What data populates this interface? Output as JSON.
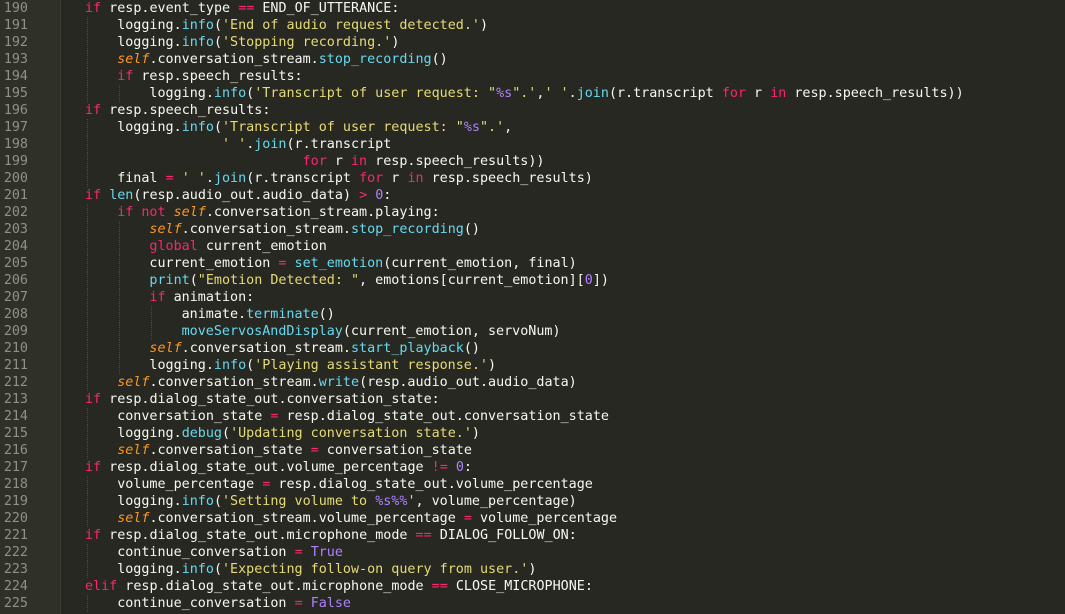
{
  "editor": {
    "theme_colors": {
      "background": "#272822",
      "gutter": "#2f3129",
      "line_number": "#8f908a",
      "plain": "#f8f8f2",
      "keyword": "#f92672",
      "function": "#66d9ef",
      "self": "#fd971f",
      "string": "#e6db74",
      "number": "#ae81ff"
    },
    "lines": [
      {
        "num": "190",
        "indent": 2,
        "tokens": [
          [
            "kw",
            "if"
          ],
          [
            "pl",
            " resp.event_type "
          ],
          [
            "kw",
            "=="
          ],
          [
            "pl",
            " END_OF_UTTERANCE:"
          ]
        ]
      },
      {
        "num": "191",
        "indent": 3,
        "tokens": [
          [
            "pl",
            "logging."
          ],
          [
            "fn",
            "info"
          ],
          [
            "pl",
            "("
          ],
          [
            "st",
            "'End of audio request detected.'"
          ],
          [
            "pl",
            ")"
          ]
        ]
      },
      {
        "num": "192",
        "indent": 3,
        "tokens": [
          [
            "pl",
            "logging."
          ],
          [
            "fn",
            "info"
          ],
          [
            "pl",
            "("
          ],
          [
            "st",
            "'Stopping recording.'"
          ],
          [
            "pl",
            ")"
          ]
        ]
      },
      {
        "num": "193",
        "indent": 3,
        "tokens": [
          [
            "slf",
            "self"
          ],
          [
            "pl",
            ".conversation_stream."
          ],
          [
            "fn",
            "stop_recording"
          ],
          [
            "pl",
            "()"
          ]
        ]
      },
      {
        "num": "194",
        "indent": 3,
        "tokens": [
          [
            "kw",
            "if"
          ],
          [
            "pl",
            " resp.speech_results:"
          ]
        ]
      },
      {
        "num": "195",
        "indent": 4,
        "tokens": [
          [
            "pl",
            "logging."
          ],
          [
            "fn",
            "info"
          ],
          [
            "pl",
            "("
          ],
          [
            "st",
            "'Transcript of user request: \""
          ],
          [
            "nm",
            "%s"
          ],
          [
            "st",
            "\".'"
          ],
          [
            "pl",
            ","
          ],
          [
            "st",
            "' '"
          ],
          [
            "pl",
            "."
          ],
          [
            "fn",
            "join"
          ],
          [
            "pl",
            "(r.transcript "
          ],
          [
            "kw",
            "for"
          ],
          [
            "pl",
            " r "
          ],
          [
            "kw",
            "in"
          ],
          [
            "pl",
            " resp.speech_results))"
          ]
        ]
      },
      {
        "num": "196",
        "indent": 2,
        "tokens": [
          [
            "kw",
            "if"
          ],
          [
            "pl",
            " resp.speech_results:"
          ]
        ]
      },
      {
        "num": "197",
        "indent": 3,
        "tokens": [
          [
            "pl",
            "logging."
          ],
          [
            "fn",
            "info"
          ],
          [
            "pl",
            "("
          ],
          [
            "st",
            "'Transcript of user request: \""
          ],
          [
            "nm",
            "%s"
          ],
          [
            "st",
            "\".'"
          ],
          [
            "pl",
            ","
          ]
        ]
      },
      {
        "num": "198",
        "indent": 3,
        "tokens": [
          [
            "pl",
            "             "
          ],
          [
            "st",
            "' '"
          ],
          [
            "pl",
            "."
          ],
          [
            "fn",
            "join"
          ],
          [
            "pl",
            "(r.transcript"
          ]
        ]
      },
      {
        "num": "199",
        "indent": 3,
        "tokens": [
          [
            "pl",
            "                       "
          ],
          [
            "kw",
            "for"
          ],
          [
            "pl",
            " r "
          ],
          [
            "kw",
            "in"
          ],
          [
            "pl",
            " resp.speech_results))"
          ]
        ]
      },
      {
        "num": "200",
        "indent": 3,
        "tokens": [
          [
            "pl",
            "final "
          ],
          [
            "kw",
            "="
          ],
          [
            "pl",
            " "
          ],
          [
            "st",
            "' '"
          ],
          [
            "pl",
            "."
          ],
          [
            "fn",
            "join"
          ],
          [
            "pl",
            "(r.transcript "
          ],
          [
            "kw",
            "for"
          ],
          [
            "pl",
            " r "
          ],
          [
            "kw",
            "in"
          ],
          [
            "pl",
            " resp.speech_results)"
          ]
        ]
      },
      {
        "num": "201",
        "indent": 2,
        "tokens": [
          [
            "kw",
            "if"
          ],
          [
            "pl",
            " "
          ],
          [
            "fn",
            "len"
          ],
          [
            "pl",
            "(resp.audio_out.audio_data) "
          ],
          [
            "kw",
            ">"
          ],
          [
            "pl",
            " "
          ],
          [
            "nm",
            "0"
          ],
          [
            "pl",
            ":"
          ]
        ]
      },
      {
        "num": "202",
        "indent": 3,
        "tokens": [
          [
            "kw",
            "if"
          ],
          [
            "pl",
            " "
          ],
          [
            "kw",
            "not"
          ],
          [
            "pl",
            " "
          ],
          [
            "slf",
            "self"
          ],
          [
            "pl",
            ".conversation_stream.playing:"
          ]
        ]
      },
      {
        "num": "203",
        "indent": 4,
        "tokens": [
          [
            "slf",
            "self"
          ],
          [
            "pl",
            ".conversation_stream."
          ],
          [
            "fn",
            "stop_recording"
          ],
          [
            "pl",
            "()"
          ]
        ]
      },
      {
        "num": "204",
        "indent": 4,
        "tokens": [
          [
            "kw",
            "global"
          ],
          [
            "pl",
            " current_emotion"
          ]
        ]
      },
      {
        "num": "205",
        "indent": 4,
        "tokens": [
          [
            "pl",
            "current_emotion "
          ],
          [
            "kw",
            "="
          ],
          [
            "pl",
            " "
          ],
          [
            "fn",
            "set_emotion"
          ],
          [
            "pl",
            "(current_emotion, final)"
          ]
        ]
      },
      {
        "num": "206",
        "indent": 4,
        "tokens": [
          [
            "fn",
            "print"
          ],
          [
            "pl",
            "("
          ],
          [
            "st",
            "\"Emotion Detected: \""
          ],
          [
            "pl",
            ", emotions[current_emotion]["
          ],
          [
            "nm",
            "0"
          ],
          [
            "pl",
            "])"
          ]
        ]
      },
      {
        "num": "207",
        "indent": 4,
        "tokens": [
          [
            "kw",
            "if"
          ],
          [
            "pl",
            " animation:"
          ]
        ]
      },
      {
        "num": "208",
        "indent": 5,
        "tokens": [
          [
            "pl",
            "animate."
          ],
          [
            "fn",
            "terminate"
          ],
          [
            "pl",
            "()"
          ]
        ]
      },
      {
        "num": "209",
        "indent": 5,
        "tokens": [
          [
            "fn",
            "moveServosAndDisplay"
          ],
          [
            "pl",
            "(current_emotion, servoNum)"
          ]
        ]
      },
      {
        "num": "210",
        "indent": 4,
        "tokens": [
          [
            "slf",
            "self"
          ],
          [
            "pl",
            ".conversation_stream."
          ],
          [
            "fn",
            "start_playback"
          ],
          [
            "pl",
            "()"
          ]
        ]
      },
      {
        "num": "211",
        "indent": 4,
        "tokens": [
          [
            "pl",
            "logging."
          ],
          [
            "fn",
            "info"
          ],
          [
            "pl",
            "("
          ],
          [
            "st",
            "'Playing assistant response.'"
          ],
          [
            "pl",
            ")"
          ]
        ]
      },
      {
        "num": "212",
        "indent": 3,
        "tokens": [
          [
            "slf",
            "self"
          ],
          [
            "pl",
            ".conversation_stream."
          ],
          [
            "fn",
            "write"
          ],
          [
            "pl",
            "(resp.audio_out.audio_data)"
          ]
        ]
      },
      {
        "num": "213",
        "indent": 2,
        "tokens": [
          [
            "kw",
            "if"
          ],
          [
            "pl",
            " resp.dialog_state_out.conversation_state:"
          ]
        ]
      },
      {
        "num": "214",
        "indent": 3,
        "tokens": [
          [
            "pl",
            "conversation_state "
          ],
          [
            "kw",
            "="
          ],
          [
            "pl",
            " resp.dialog_state_out.conversation_state"
          ]
        ]
      },
      {
        "num": "215",
        "indent": 3,
        "tokens": [
          [
            "pl",
            "logging."
          ],
          [
            "fn",
            "debug"
          ],
          [
            "pl",
            "("
          ],
          [
            "st",
            "'Updating conversation state.'"
          ],
          [
            "pl",
            ")"
          ]
        ]
      },
      {
        "num": "216",
        "indent": 3,
        "tokens": [
          [
            "slf",
            "self"
          ],
          [
            "pl",
            ".conversation_state "
          ],
          [
            "kw",
            "="
          ],
          [
            "pl",
            " conversation_state"
          ]
        ]
      },
      {
        "num": "217",
        "indent": 2,
        "tokens": [
          [
            "kw",
            "if"
          ],
          [
            "pl",
            " resp.dialog_state_out.volume_percentage "
          ],
          [
            "kw",
            "!="
          ],
          [
            "pl",
            " "
          ],
          [
            "nm",
            "0"
          ],
          [
            "pl",
            ":"
          ]
        ]
      },
      {
        "num": "218",
        "indent": 3,
        "tokens": [
          [
            "pl",
            "volume_percentage "
          ],
          [
            "kw",
            "="
          ],
          [
            "pl",
            " resp.dialog_state_out.volume_percentage"
          ]
        ]
      },
      {
        "num": "219",
        "indent": 3,
        "tokens": [
          [
            "pl",
            "logging."
          ],
          [
            "fn",
            "info"
          ],
          [
            "pl",
            "("
          ],
          [
            "st",
            "'Setting volume to "
          ],
          [
            "nm",
            "%s%%"
          ],
          [
            "st",
            "'"
          ],
          [
            "pl",
            ", volume_percentage)"
          ]
        ]
      },
      {
        "num": "220",
        "indent": 3,
        "tokens": [
          [
            "slf",
            "self"
          ],
          [
            "pl",
            ".conversation_stream.volume_percentage "
          ],
          [
            "kw",
            "="
          ],
          [
            "pl",
            " volume_percentage"
          ]
        ]
      },
      {
        "num": "221",
        "indent": 2,
        "tokens": [
          [
            "kw",
            "if"
          ],
          [
            "pl",
            " resp.dialog_state_out.microphone_mode "
          ],
          [
            "kw",
            "=="
          ],
          [
            "pl",
            " DIALOG_FOLLOW_ON:"
          ]
        ]
      },
      {
        "num": "222",
        "indent": 3,
        "tokens": [
          [
            "pl",
            "continue_conversation "
          ],
          [
            "kw",
            "="
          ],
          [
            "pl",
            " "
          ],
          [
            "cn",
            "True"
          ]
        ]
      },
      {
        "num": "223",
        "indent": 3,
        "tokens": [
          [
            "pl",
            "logging."
          ],
          [
            "fn",
            "info"
          ],
          [
            "pl",
            "("
          ],
          [
            "st",
            "'Expecting follow-on query from user.'"
          ],
          [
            "pl",
            ")"
          ]
        ]
      },
      {
        "num": "224",
        "indent": 2,
        "tokens": [
          [
            "kw",
            "elif"
          ],
          [
            "pl",
            " resp.dialog_state_out.microphone_mode "
          ],
          [
            "kw",
            "=="
          ],
          [
            "pl",
            " CLOSE_MICROPHONE:"
          ]
        ]
      },
      {
        "num": "225",
        "indent": 3,
        "tokens": [
          [
            "pl",
            "continue_conversation "
          ],
          [
            "kw",
            "="
          ],
          [
            "pl",
            " "
          ],
          [
            "cn",
            "False"
          ]
        ]
      }
    ]
  }
}
